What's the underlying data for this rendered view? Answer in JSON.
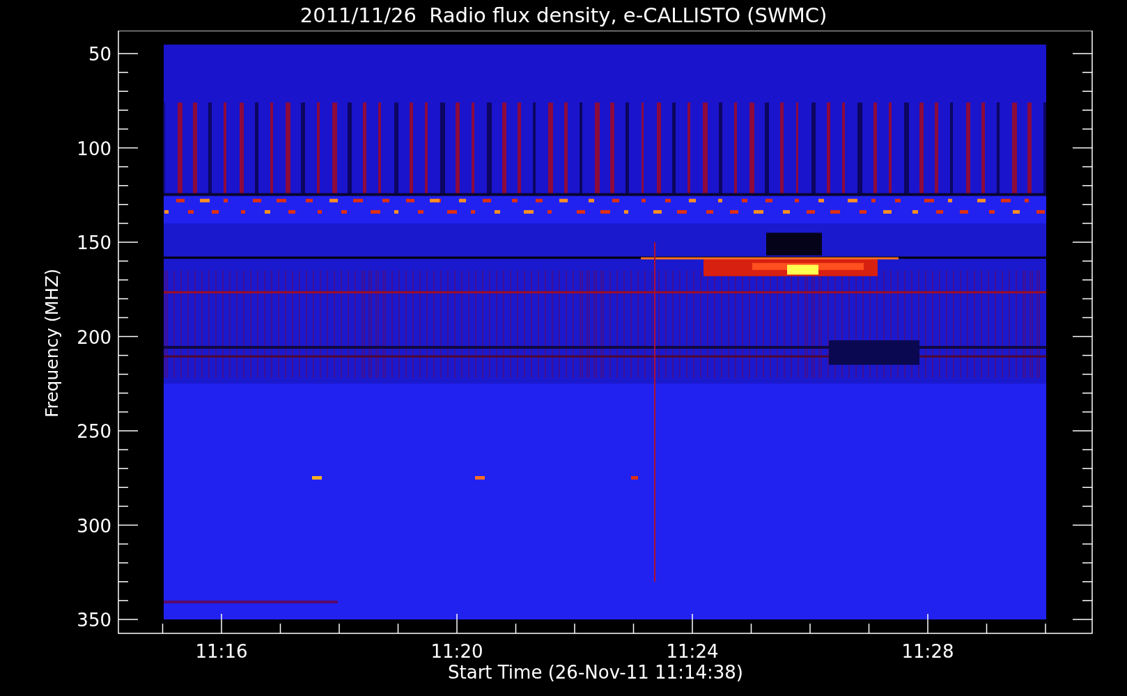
{
  "title": "2011/11/26  Radio flux density, e-CALLISTO (SWMC)",
  "y_axis": {
    "label": "Frequency (MHZ)",
    "ticks": [
      "50",
      "100",
      "150",
      "200",
      "250",
      "300",
      "350"
    ]
  },
  "x_axis": {
    "label": "Start Time (26-Nov-11 11:14:38)",
    "ticks": [
      "11:16",
      "11:20",
      "11:24",
      "11:28"
    ]
  }
}
